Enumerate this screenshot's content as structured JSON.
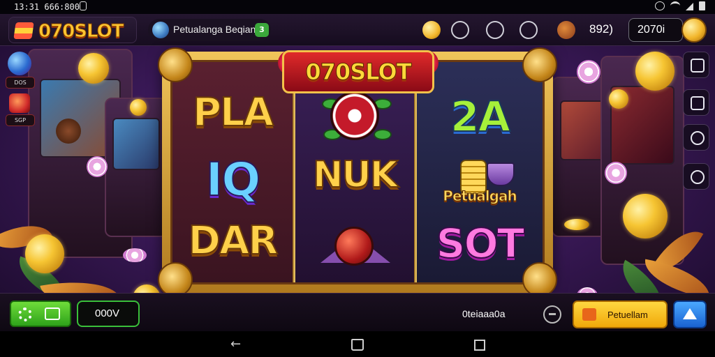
{
  "status_bar": {
    "time": "13:31 666:800"
  },
  "header": {
    "logo_text": "070SLOT",
    "adventure_label": "Petualanga Beqian",
    "adventure_badge": "3",
    "count": "892)",
    "balance": "2070i"
  },
  "left_side": {
    "items": [
      {
        "label": "DOS"
      },
      {
        "label": "SGP"
      }
    ]
  },
  "slot": {
    "banner": "070SLOT",
    "reels": [
      {
        "symbols": [
          "PLA",
          "IQ",
          "DAR"
        ]
      },
      {
        "symbols": [
          "",
          "NUK",
          ""
        ]
      },
      {
        "symbols": [
          "2A",
          "Petualgah",
          "SOT"
        ]
      }
    ]
  },
  "bottom_bar": {
    "bet_value": "000V",
    "winnings_label": "0teiaaa0a",
    "spin_label": "Petuellam"
  },
  "colors": {
    "gold": "#ffc531",
    "green_button": "#3ab82a",
    "yellow_button": "#ffc924",
    "blue_button": "#2a7ae8"
  }
}
